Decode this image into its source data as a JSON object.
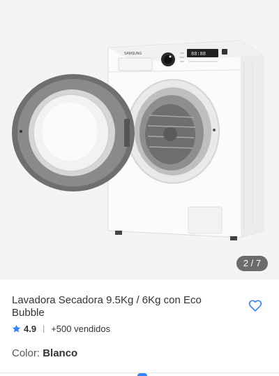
{
  "gallery": {
    "image_alt": "Lavadora Secadora Samsung blanca con puerta abierta",
    "brand_label": "SAMSUNG",
    "display_readout": "88:88",
    "counter": "2 / 7"
  },
  "product": {
    "title": "Lavadora Secadora 9.5Kg / 6Kg con Eco Bubble",
    "rating": "4.9",
    "separator": "|",
    "sold": "+500 vendidos",
    "color_label": "Color: ",
    "color_value": "Blanco"
  },
  "colors": {
    "accent": "#3483fa",
    "counter_bg": "#6b6b6b",
    "text": "#333333"
  },
  "icons": {
    "favorite": "heart-outline-icon",
    "rating": "star-icon"
  }
}
